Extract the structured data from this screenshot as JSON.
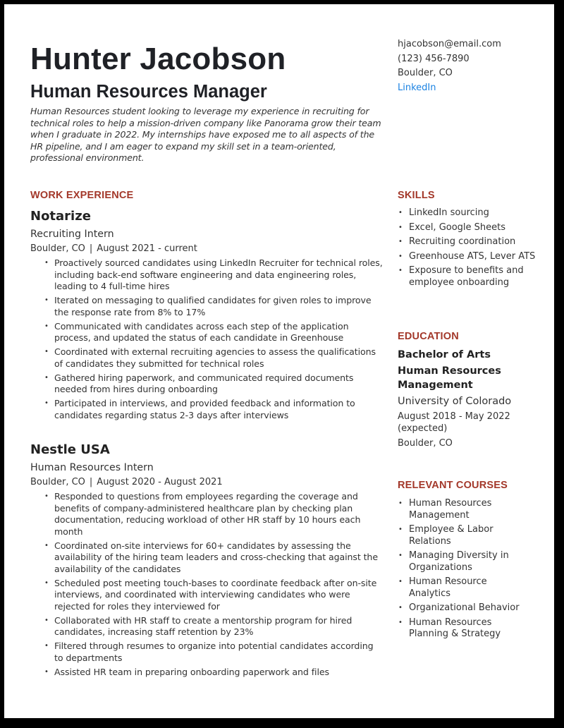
{
  "header": {
    "name": "Hunter Jacobson",
    "title": "Human Resources Manager",
    "summary": "Human Resources student looking to leverage my experience in recruiting for technical roles to help a mission-driven company like Panorama grow their team when I graduate in 2022. My internships have exposed me to all aspects of the HR pipeline, and I am eager to expand my skill set in a team-oriented, professional environment."
  },
  "contact": {
    "email": "hjacobson@email.com",
    "phone": "(123) 456-7890",
    "location": "Boulder, CO",
    "linkedin": "LinkedIn"
  },
  "colors": {
    "heading": "#a3382a",
    "link": "#1a82e2",
    "text": "#333333",
    "name": "#1f2126"
  },
  "work": {
    "heading": "WORK EXPERIENCE",
    "jobs": [
      {
        "company": "Notarize",
        "role": "Recruiting Intern",
        "location": "Boulder, CO",
        "separator": "|",
        "dates": "August 2021 - current",
        "bullets": [
          "Proactively sourced candidates using LinkedIn Recruiter for technical roles, including back-end software engineering and data engineering roles, leading to 4 full-time hires",
          "Iterated on messaging to qualified candidates for given roles to improve the response rate from 8% to 17%",
          "Communicated with candidates across each step of the application process, and updated the status of each candidate in Greenhouse",
          "Coordinated with external recruiting agencies to assess the qualifications of candidates they submitted for technical roles",
          "Gathered hiring paperwork, and communicated required documents needed from hires during onboarding",
          "Participated in interviews, and provided feedback and information to candidates regarding status 2-3 days after interviews"
        ]
      },
      {
        "company": "Nestle USA",
        "role": "Human Resources Intern",
        "location": "Boulder, CO",
        "separator": "|",
        "dates": "August 2020 - August 2021",
        "bullets": [
          "Responded to questions from employees regarding the coverage and benefits of company-administered healthcare plan by checking plan documentation, reducing workload of other HR staff by 10 hours each month",
          "Coordinated on-site interviews for 60+ candidates by assessing the availability of the hiring team leaders and cross-checking that against the availability of the candidates",
          "Scheduled post meeting touch-bases to coordinate feedback after on-site interviews, and coordinated with interviewing candidates who were rejected for roles they interviewed for",
          "Collaborated with HR staff to create a mentorship program for hired candidates, increasing staff retention by 23%",
          "Filtered through resumes to organize into potential candidates according to departments",
          "Assisted HR team in preparing onboarding paperwork and files"
        ]
      }
    ]
  },
  "skills": {
    "heading": "SKILLS",
    "items": [
      "LinkedIn sourcing",
      "Excel, Google Sheets",
      "Recruiting coordination",
      "Greenhouse ATS, Lever ATS",
      "Exposure to benefits and employee onboarding"
    ]
  },
  "education": {
    "heading": "EDUCATION",
    "degree": "Bachelor of Arts",
    "major": "Human Resources Management",
    "school": "University of Colorado",
    "dates": "August 2018 - May 2022 (expected)",
    "location": "Boulder, CO"
  },
  "courses": {
    "heading": "RELEVANT COURSES",
    "items": [
      "Human Resources Management",
      "Employee & Labor Relations",
      "Managing Diversity in Organizations",
      "Human Resource Analytics",
      "Organizational Behavior",
      "Human Resources Planning & Strategy"
    ]
  }
}
